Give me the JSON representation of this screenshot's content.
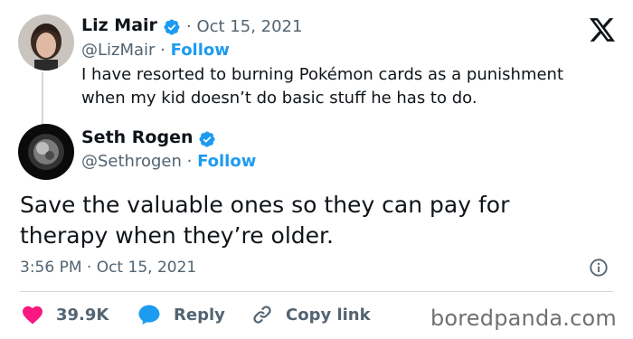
{
  "tweet": {
    "author": {
      "name": "Liz Mair",
      "handle": "@LizMair",
      "verified": true
    },
    "date": "Oct 15, 2021",
    "follow_label": "Follow",
    "text_line1": "I have resorted to burning Pokémon cards as a punishment",
    "text_line2": "when my kid doesn’t do basic stuff he has to do."
  },
  "reply": {
    "author": {
      "name": "Seth Rogen",
      "handle": "@Sethrogen",
      "verified": true
    },
    "follow_label": "Follow",
    "text_line1": "Save the valuable ones so they can pay for",
    "text_line2": "therapy when they’re older.",
    "timestamp": "3:56 PM · Oct 15, 2021"
  },
  "actions": {
    "likes": "39.9K",
    "reply_label": "Reply",
    "copy_link_label": "Copy link"
  },
  "watermark": "boredpanda.com",
  "icons": {
    "logo": "x-logo-icon",
    "verified": "verified-badge-icon",
    "info": "info-icon",
    "like": "heart-icon",
    "reply": "speech-bubble-icon",
    "link": "link-icon"
  },
  "colors": {
    "accent": "#1d9bf0",
    "like": "#f91880",
    "muted": "#536471",
    "text": "#0f1419"
  }
}
